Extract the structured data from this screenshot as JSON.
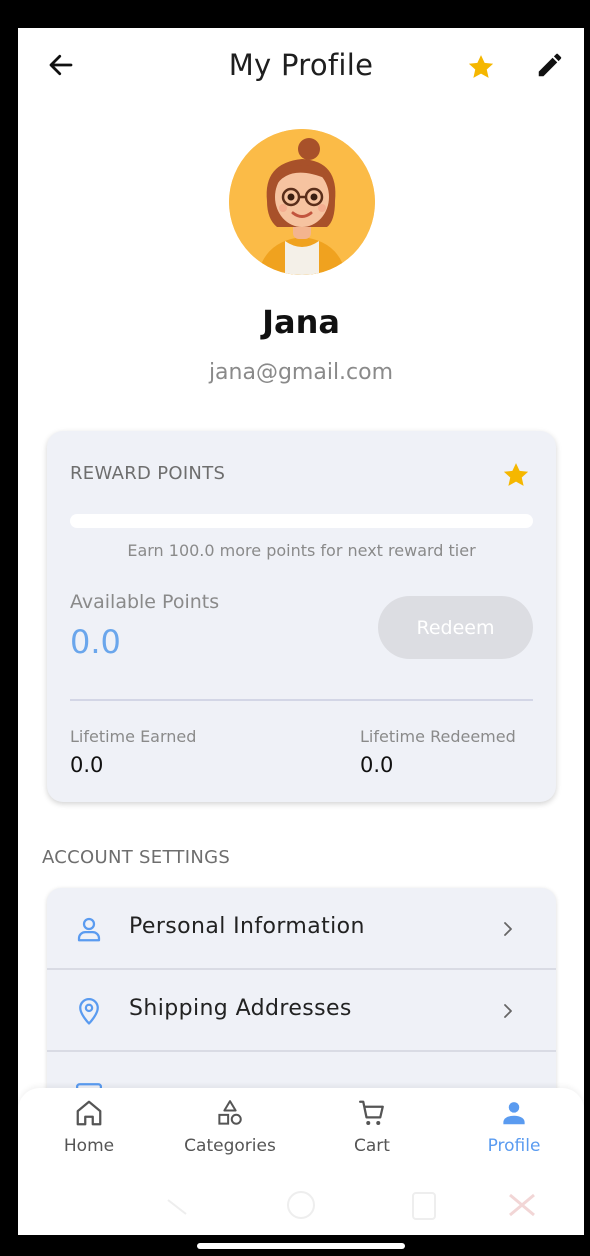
{
  "header": {
    "title": "My Profile"
  },
  "profile": {
    "name": "Jana",
    "email": "jana@gmail.com"
  },
  "rewards": {
    "title": "REWARD POINTS",
    "progress_fraction": 0,
    "earn_message": "Earn 100.0 more points for next reward tier",
    "available_label": "Available Points",
    "available_value": "0.0",
    "redeem_label": "Redeem",
    "lifetime_earned_label": "Lifetime Earned",
    "lifetime_earned_value": "0.0",
    "lifetime_redeemed_label": "Lifetime Redeemed",
    "lifetime_redeemed_value": "0.0"
  },
  "account_settings": {
    "title": "ACCOUNT SETTINGS",
    "items": [
      {
        "label": "Personal Information",
        "icon": "person-icon"
      },
      {
        "label": "Shipping Addresses",
        "icon": "location-pin-icon"
      },
      {
        "label": "",
        "icon": "payment-card-icon"
      }
    ]
  },
  "bottom_nav": {
    "items": [
      {
        "label": "Home",
        "icon": "home-icon",
        "active": false
      },
      {
        "label": "Categories",
        "icon": "shapes-icon",
        "active": false
      },
      {
        "label": "Cart",
        "icon": "cart-icon",
        "active": false
      },
      {
        "label": "Profile",
        "icon": "person-filled-icon",
        "active": true
      }
    ]
  },
  "colors": {
    "accent": "#5a9bf0",
    "star": "#f5b700",
    "card_bg": "#eff1f7",
    "avatar_bg": "#fbbb47"
  }
}
